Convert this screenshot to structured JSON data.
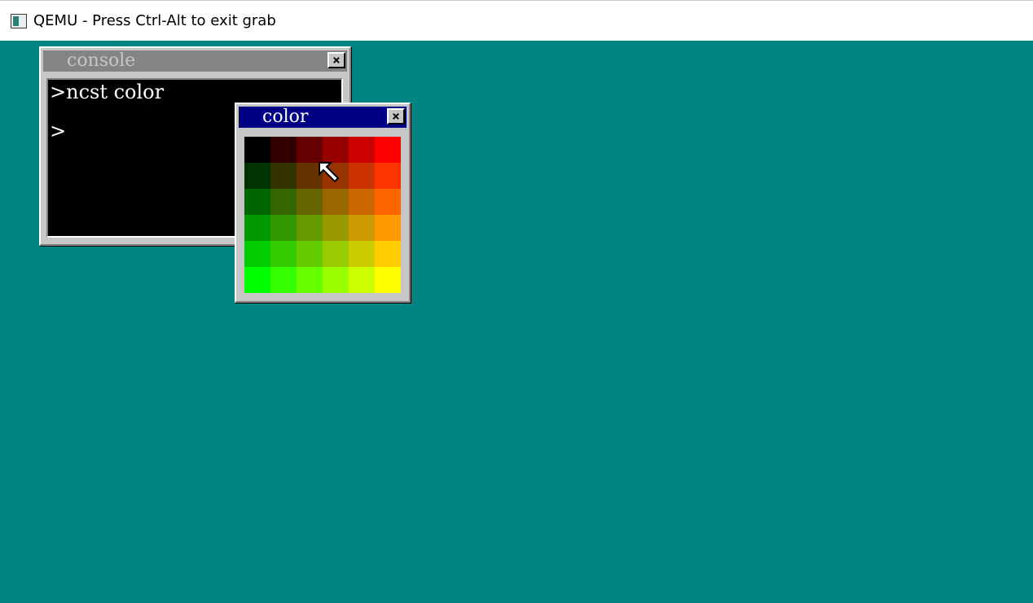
{
  "host_window": {
    "title": "QEMU - Press Ctrl-Alt to exit grab",
    "icon": "qemu-app-icon"
  },
  "desktop": {
    "background_color": "#008484"
  },
  "console_window": {
    "title": "console",
    "state": "inactive",
    "close_icon": "close-x-icon",
    "lines": [
      ">ncst color",
      ">"
    ]
  },
  "color_window": {
    "title": "color",
    "state": "active",
    "close_icon": "close-x-icon",
    "rows": [
      [
        "#000000",
        "#330000",
        "#660000",
        "#990000",
        "#cc0000",
        "#ff0000"
      ],
      [
        "#003300",
        "#333300",
        "#663300",
        "#993300",
        "#cc3300",
        "#ff3300"
      ],
      [
        "#006600",
        "#336600",
        "#666600",
        "#996600",
        "#cc6600",
        "#ff6600"
      ],
      [
        "#009900",
        "#339900",
        "#669900",
        "#999900",
        "#cc9900",
        "#ff9900"
      ],
      [
        "#00cc00",
        "#33cc00",
        "#66cc00",
        "#99cc00",
        "#cccc00",
        "#ffcc00"
      ],
      [
        "#00ff00",
        "#33ff00",
        "#66ff00",
        "#99ff00",
        "#ccff00",
        "#ffff00"
      ]
    ]
  },
  "cursor": {
    "icon": "mouse-arrow-icon"
  }
}
